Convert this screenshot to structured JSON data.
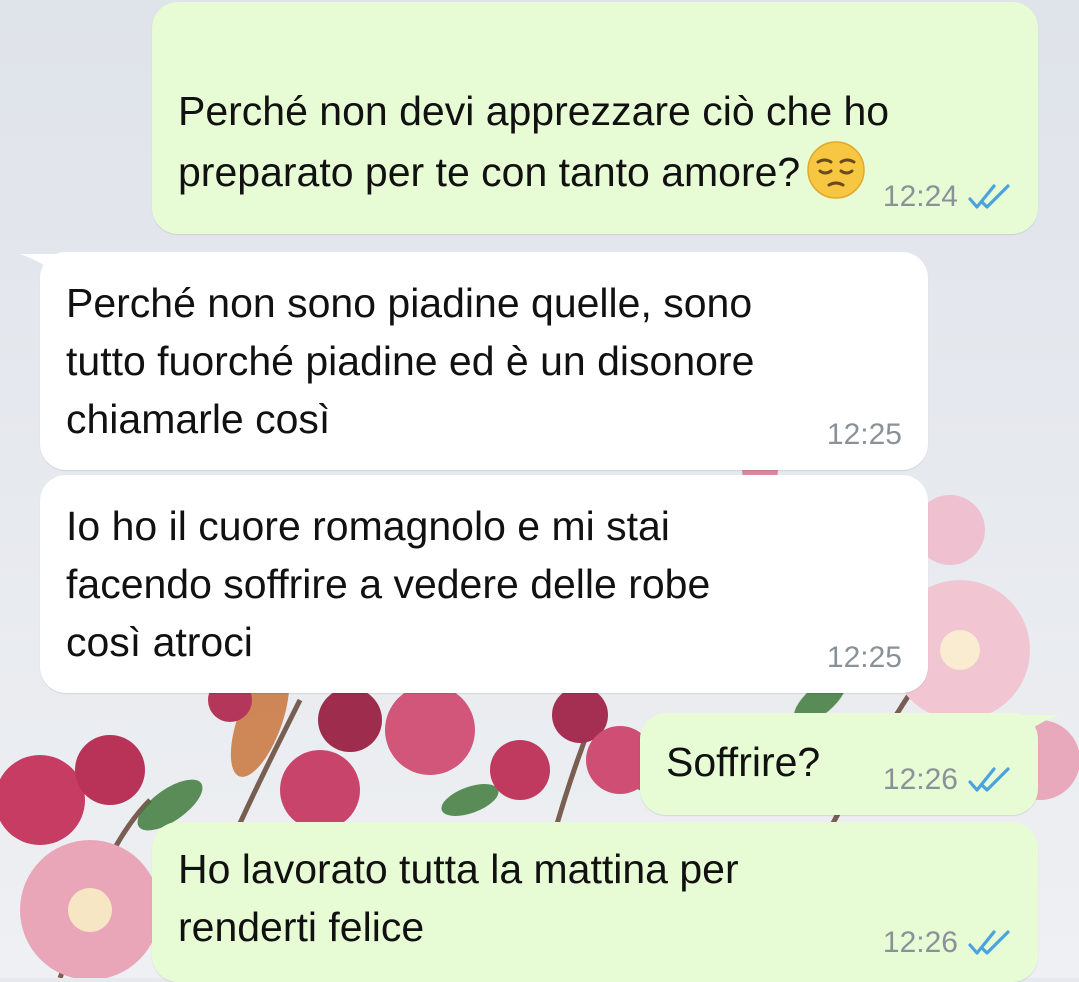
{
  "chat": {
    "colors": {
      "outgoing_bubble": "#e7fbd4",
      "incoming_bubble": "#ffffff",
      "timestamp": "#8a9299",
      "read_ticks": "#4aa3e0"
    },
    "messages": [
      {
        "direction": "outgoing",
        "text": "Perché non devi apprezzare ciò che ho\npreparato per te con tanto amore?",
        "emoji": "pensive-face",
        "time": "12:24",
        "status": "read"
      },
      {
        "direction": "incoming",
        "text": "Perché non sono piadine quelle, sono\ntutto fuorché piadine ed è un disonore\nchiamarle così",
        "time": "12:25"
      },
      {
        "direction": "incoming",
        "text": "Io ho il cuore romagnolo e mi stai\nfacendo soffrire a vedere delle robe\ncosì atroci",
        "time": "12:25"
      },
      {
        "direction": "outgoing",
        "text": "Soffrire?",
        "time": "12:26",
        "status": "read"
      },
      {
        "direction": "outgoing",
        "text": "Ho lavorato tutta la mattina per\nrenderti felice",
        "time": "12:26",
        "status": "read"
      }
    ]
  }
}
